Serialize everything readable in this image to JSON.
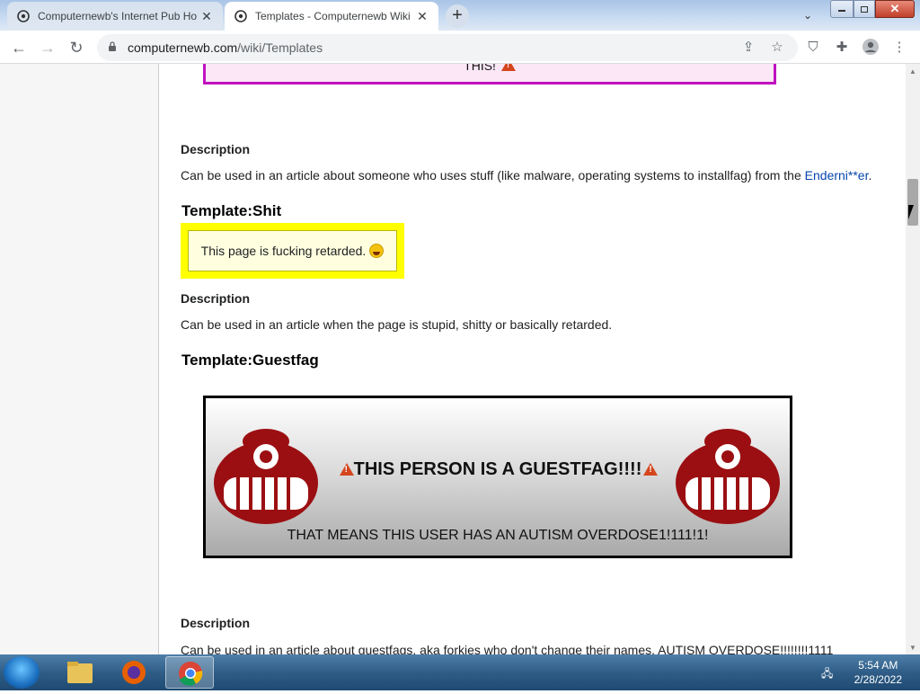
{
  "browser": {
    "tabs": [
      {
        "title": "Computernewb's Internet Pub Ho",
        "active": false
      },
      {
        "title": "Templates - Computernewb Wiki",
        "active": true
      }
    ],
    "url_host": "computernewb.com",
    "url_path": "/wiki/Templates",
    "new_tab_label": "+"
  },
  "page": {
    "magenta_box_text": "THIS!",
    "sections": [
      {
        "desc_heading": "Description",
        "desc_text_before": "Can be used in an article about someone who uses stuff (like malware, operating systems to installfag) from the ",
        "desc_link": "Enderni**er",
        "desc_text_after": "."
      },
      {
        "template_heading": "Template:Shit",
        "box_text": "This page is fucking retarded.",
        "desc_heading": "Description",
        "desc_text": "Can be used in an article when the page is stupid, shitty or basically retarded."
      },
      {
        "template_heading": "Template:Guestfag",
        "box_title": "THIS PERSON IS A GUESTFAG!!!!",
        "box_subtitle": "THAT MEANS THIS USER HAS AN AUTISM OVERDOSE1!111!1!",
        "desc_heading": "Description",
        "desc_text": "Can be used in an article about guestfags, aka forkies who don't change their names. AUTISM OVERDOSE!!!!!!!!1111"
      }
    ]
  },
  "taskbar": {
    "time": "5:54 AM",
    "date": "2/28/2022"
  },
  "colors": {
    "magenta_border": "#c012c0",
    "yellow_box": "#ffff00",
    "link": "#0645ad"
  }
}
